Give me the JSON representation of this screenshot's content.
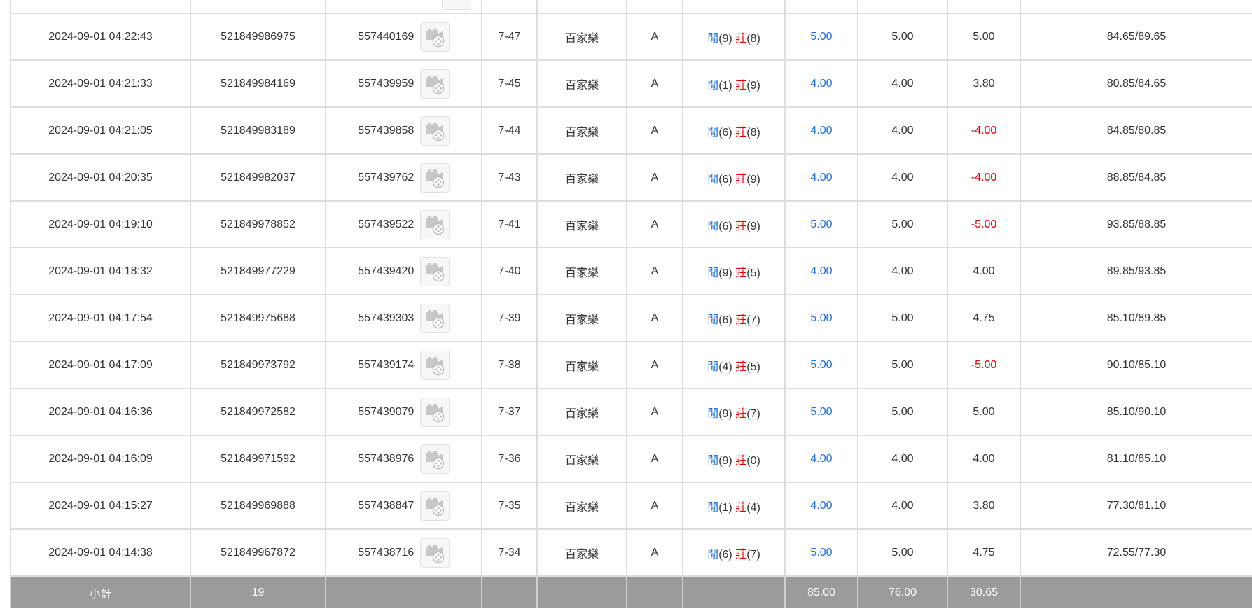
{
  "records": [
    {
      "time": "2024-09-01 04:22:43",
      "bet_id": "521849986975",
      "round_id": "557440169",
      "table_no": "7-47",
      "game": "百家樂",
      "table_type": "A",
      "player_label": "閒",
      "player_pts": "(9)",
      "banker_label": "莊",
      "banker_pts": "(8)",
      "bet": "5.00",
      "valid_bet": "5.00",
      "win_loss": "5.00",
      "win_loss_color": "#333333",
      "balance": "84.65/89.65"
    },
    {
      "time": "2024-09-01 04:21:33",
      "bet_id": "521849984169",
      "round_id": "557439959",
      "table_no": "7-45",
      "game": "百家樂",
      "table_type": "A",
      "player_label": "閒",
      "player_pts": "(1)",
      "banker_label": "莊",
      "banker_pts": "(9)",
      "bet": "4.00",
      "valid_bet": "4.00",
      "win_loss": "3.80",
      "win_loss_color": "#333333",
      "balance": "80.85/84.65"
    },
    {
      "time": "2024-09-01 04:21:05",
      "bet_id": "521849983189",
      "round_id": "557439858",
      "table_no": "7-44",
      "game": "百家樂",
      "table_type": "A",
      "player_label": "閒",
      "player_pts": "(6)",
      "banker_label": "莊",
      "banker_pts": "(8)",
      "bet": "4.00",
      "valid_bet": "4.00",
      "win_loss": "-4.00",
      "win_loss_color": "#e60000",
      "balance": "84.85/80.85"
    },
    {
      "time": "2024-09-01 04:20:35",
      "bet_id": "521849982037",
      "round_id": "557439762",
      "table_no": "7-43",
      "game": "百家樂",
      "table_type": "A",
      "player_label": "閒",
      "player_pts": "(6)",
      "banker_label": "莊",
      "banker_pts": "(9)",
      "bet": "4.00",
      "valid_bet": "4.00",
      "win_loss": "-4.00",
      "win_loss_color": "#e60000",
      "balance": "88.85/84.85"
    },
    {
      "time": "2024-09-01 04:19:10",
      "bet_id": "521849978852",
      "round_id": "557439522",
      "table_no": "7-41",
      "game": "百家樂",
      "table_type": "A",
      "player_label": "閒",
      "player_pts": "(6)",
      "banker_label": "莊",
      "banker_pts": "(9)",
      "bet": "5.00",
      "valid_bet": "5.00",
      "win_loss": "-5.00",
      "win_loss_color": "#e60000",
      "balance": "93.85/88.85"
    },
    {
      "time": "2024-09-01 04:18:32",
      "bet_id": "521849977229",
      "round_id": "557439420",
      "table_no": "7-40",
      "game": "百家樂",
      "table_type": "A",
      "player_label": "閒",
      "player_pts": "(9)",
      "banker_label": "莊",
      "banker_pts": "(5)",
      "bet": "4.00",
      "valid_bet": "4.00",
      "win_loss": "4.00",
      "win_loss_color": "#333333",
      "balance": "89.85/93.85"
    },
    {
      "time": "2024-09-01 04:17:54",
      "bet_id": "521849975688",
      "round_id": "557439303",
      "table_no": "7-39",
      "game": "百家樂",
      "table_type": "A",
      "player_label": "閒",
      "player_pts": "(6)",
      "banker_label": "莊",
      "banker_pts": "(7)",
      "bet": "5.00",
      "valid_bet": "5.00",
      "win_loss": "4.75",
      "win_loss_color": "#333333",
      "balance": "85.10/89.85"
    },
    {
      "time": "2024-09-01 04:17:09",
      "bet_id": "521849973792",
      "round_id": "557439174",
      "table_no": "7-38",
      "game": "百家樂",
      "table_type": "A",
      "player_label": "閒",
      "player_pts": "(4)",
      "banker_label": "莊",
      "banker_pts": "(5)",
      "bet": "5.00",
      "valid_bet": "5.00",
      "win_loss": "-5.00",
      "win_loss_color": "#e60000",
      "balance": "90.10/85.10"
    },
    {
      "time": "2024-09-01 04:16:36",
      "bet_id": "521849972582",
      "round_id": "557439079",
      "table_no": "7-37",
      "game": "百家樂",
      "table_type": "A",
      "player_label": "閒",
      "player_pts": "(9)",
      "banker_label": "莊",
      "banker_pts": "(7)",
      "bet": "5.00",
      "valid_bet": "5.00",
      "win_loss": "5.00",
      "win_loss_color": "#333333",
      "balance": "85.10/90.10"
    },
    {
      "time": "2024-09-01 04:16:09",
      "bet_id": "521849971592",
      "round_id": "557438976",
      "table_no": "7-36",
      "game": "百家樂",
      "table_type": "A",
      "player_label": "閒",
      "player_pts": "(9)",
      "banker_label": "莊",
      "banker_pts": "(0)",
      "bet": "4.00",
      "valid_bet": "4.00",
      "win_loss": "4.00",
      "win_loss_color": "#333333",
      "balance": "81.10/85.10"
    },
    {
      "time": "2024-09-01 04:15:27",
      "bet_id": "521849969888",
      "round_id": "557438847",
      "table_no": "7-35",
      "game": "百家樂",
      "table_type": "A",
      "player_label": "閒",
      "player_pts": "(1)",
      "banker_label": "莊",
      "banker_pts": "(4)",
      "bet": "4.00",
      "valid_bet": "4.00",
      "win_loss": "3.80",
      "win_loss_color": "#333333",
      "balance": "77.30/81.10"
    },
    {
      "time": "2024-09-01 04:14:38",
      "bet_id": "521849967872",
      "round_id": "557438716",
      "table_no": "7-34",
      "game": "百家樂",
      "table_type": "A",
      "player_label": "閒",
      "player_pts": "(6)",
      "banker_label": "莊",
      "banker_pts": "(7)",
      "bet": "5.00",
      "valid_bet": "5.00",
      "win_loss": "4.75",
      "win_loss_color": "#333333",
      "balance": "72.55/77.30"
    }
  ],
  "subtotal": {
    "label": "小計",
    "count": "19",
    "bet": "85.00",
    "valid_bet": "76.00",
    "win_loss": "30.65"
  },
  "colors": {
    "player_blue": "#1e6fd9",
    "banker_red": "#e60000",
    "loss_red": "#e60000",
    "subtotal_bg": "#9b9b9b",
    "border": "#dddddd"
  },
  "icons": {
    "replay": "video-replay-icon"
  }
}
